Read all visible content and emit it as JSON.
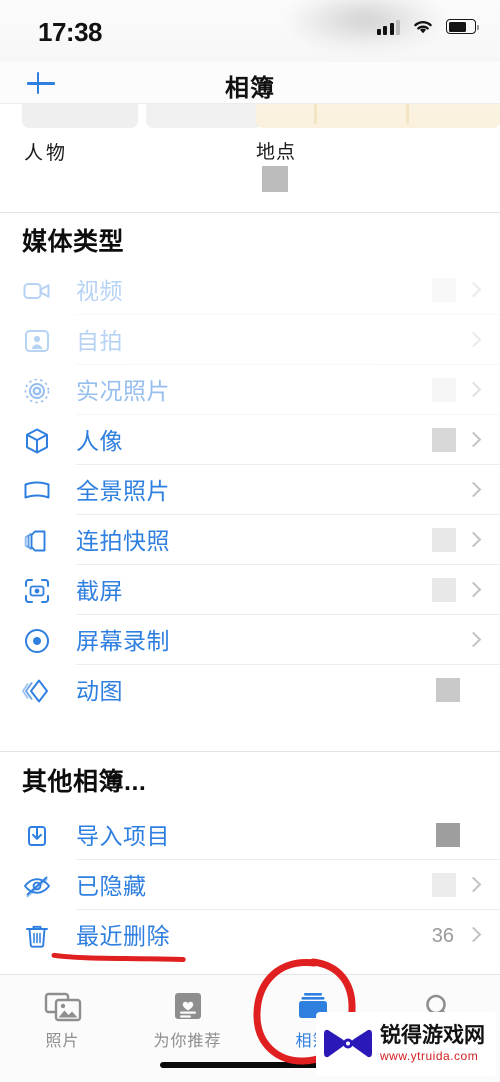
{
  "status_bar": {
    "time": "17:38",
    "signal_icon": "cellular-signal-icon",
    "wifi_icon": "wifi-icon",
    "battery_icon": "battery-icon"
  },
  "nav_bar": {
    "add_label": "+",
    "title": "相簿"
  },
  "top_albums": [
    {
      "label": "人物",
      "icon": "people-album-card"
    },
    {
      "label": "地点",
      "icon": "places-album-card",
      "redacted": true
    }
  ],
  "sections": [
    {
      "title": "媒体类型",
      "rows": [
        {
          "label": "视频",
          "icon": "video-icon",
          "count": "",
          "redacted": true,
          "chevron": true,
          "faded": true
        },
        {
          "label": "自拍",
          "icon": "selfie-icon",
          "count": "",
          "redacted": false,
          "chevron": true,
          "faded": true
        },
        {
          "label": "实况照片",
          "icon": "live-photo-icon",
          "count": "",
          "redacted": true,
          "chevron": true,
          "faded": false
        },
        {
          "label": "人像",
          "icon": "portrait-cube-icon",
          "count": "",
          "redacted": true,
          "chevron": true,
          "faded": false
        },
        {
          "label": "全景照片",
          "icon": "panorama-icon",
          "count": "",
          "redacted": false,
          "chevron": true,
          "faded": false
        },
        {
          "label": "连拍快照",
          "icon": "burst-icon",
          "count": "",
          "redacted": true,
          "chevron": true,
          "faded": false
        },
        {
          "label": "截屏",
          "icon": "screenshot-icon",
          "count": "",
          "redacted": true,
          "chevron": true,
          "faded": false
        },
        {
          "label": "屏幕录制",
          "icon": "screen-recording-icon",
          "count": "",
          "redacted": false,
          "chevron": true,
          "faded": false
        },
        {
          "label": "动图",
          "icon": "animated-gif-icon",
          "count": "",
          "redacted": true,
          "chevron": false,
          "faded": false
        }
      ]
    },
    {
      "title": "其他相簿...",
      "rows": [
        {
          "label": "导入项目",
          "icon": "import-icon",
          "count": "",
          "redacted": true,
          "chevron": false,
          "faded": false
        },
        {
          "label": "已隐藏",
          "icon": "hidden-icon",
          "count": "",
          "redacted": true,
          "chevron": true,
          "faded": false
        },
        {
          "label": "最近删除",
          "icon": "trash-icon",
          "count": "36",
          "redacted": false,
          "chevron": true,
          "faded": false
        }
      ]
    }
  ],
  "tab_bar": [
    {
      "label": "照片",
      "icon": "photos-icon",
      "active": false
    },
    {
      "label": "为你推荐",
      "icon": "for-you-icon",
      "active": false
    },
    {
      "label": "相簿",
      "icon": "albums-icon",
      "active": true
    },
    {
      "label": "搜索",
      "icon": "search-icon",
      "active": false
    }
  ],
  "annotations": [
    {
      "name": "red-underline-recently-deleted",
      "color": "#e02020"
    },
    {
      "name": "red-circle-albums-tab",
      "color": "#e02020"
    }
  ],
  "watermark": {
    "site_name": "锐得游戏网",
    "url": "www.ytruida.com",
    "logo_icon": "bowtie-logo-icon",
    "name_color": "#121212",
    "url_color": "#d01f1f"
  },
  "colors": {
    "accent": "#2f7fe0",
    "background": "#ffffff",
    "divider": "#ececec",
    "secondary_text": "#9a9a9a",
    "annotation_red": "#e02020"
  }
}
